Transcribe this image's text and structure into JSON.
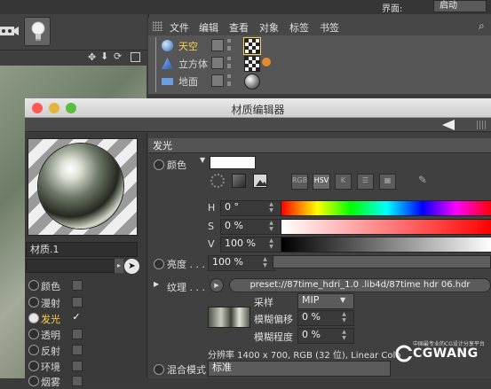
{
  "top_bar": {
    "layout_label": "界面:",
    "layout_value": "启动"
  },
  "object_manager": {
    "menu": [
      "文件",
      "编辑",
      "查看",
      "对象",
      "标签",
      "书签"
    ],
    "objects": [
      {
        "name": "天空",
        "highlight": true,
        "icon": "sky-icon"
      },
      {
        "name": "立方体",
        "highlight": false,
        "icon": "cube-icon"
      },
      {
        "name": "地面",
        "highlight": false,
        "icon": "floor-icon"
      }
    ]
  },
  "material_editor": {
    "title": "材质编辑器",
    "material_name": "材质.1",
    "channels": [
      {
        "label": "颜色",
        "checked": false,
        "active": false
      },
      {
        "label": "漫射",
        "checked": false,
        "active": false
      },
      {
        "label": "发光",
        "checked": true,
        "active": true
      },
      {
        "label": "透明",
        "checked": false,
        "active": false
      },
      {
        "label": "反射",
        "checked": false,
        "active": false
      },
      {
        "label": "环境",
        "checked": false,
        "active": false
      },
      {
        "label": "烟雾",
        "checked": false,
        "active": false
      }
    ],
    "section_title": "发光",
    "color_label": "颜色",
    "color_value": "#ffffff",
    "mode_buttons": [
      "RGB",
      "HSV",
      "K"
    ],
    "h": {
      "label": "H",
      "value": "0 °"
    },
    "s": {
      "label": "S",
      "value": "0 %"
    },
    "v": {
      "label": "V",
      "value": "100 %"
    },
    "brightness": {
      "label": "亮度 . . .",
      "value": "100 %"
    },
    "texture": {
      "label": "纹理 . . .",
      "path": "preset://87time_hdri_1.0 .lib4d/87time hdr 06.hdr",
      "sampling_label": "采样",
      "sampling_value": "MIP",
      "blur_offset_label": "模糊偏移",
      "blur_offset_value": "0 %",
      "blur_scale_label": "模糊程度",
      "blur_scale_value": "0 %",
      "resolution": "分辨率 1400 x 700, RGB (32 位), Linear Colo"
    },
    "blend_mode": {
      "label": "混合模式",
      "value": "标准"
    }
  },
  "watermark": {
    "name": "CGWANG",
    "tagline": "中国最专业的CG设计分享平台"
  }
}
